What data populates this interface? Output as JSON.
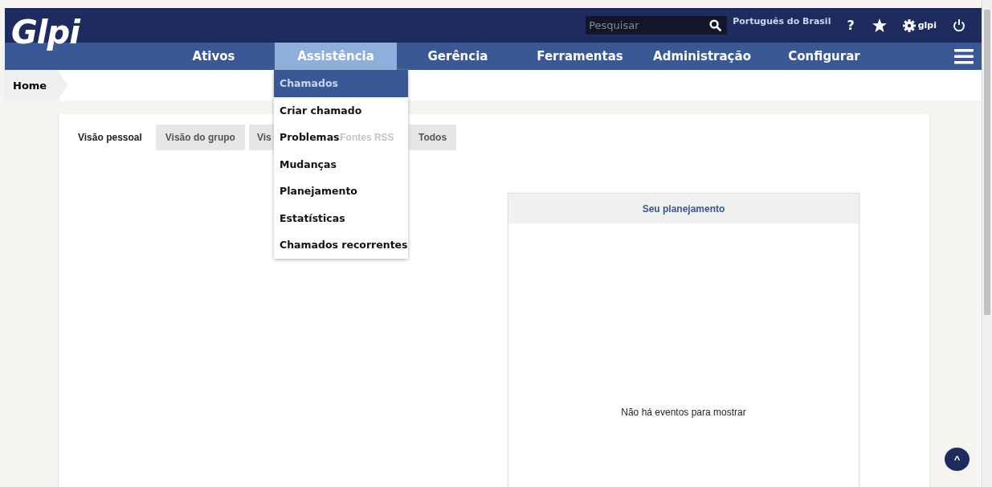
{
  "header": {
    "logo": "Glpi",
    "search": {
      "placeholder": "Pesquisar"
    },
    "language": "Português do Brasil",
    "help": "?",
    "user": "glpi"
  },
  "nav": [
    {
      "label": "Ativos",
      "selected": false
    },
    {
      "label": "Assistência",
      "selected": true
    },
    {
      "label": "Gerência",
      "selected": false
    },
    {
      "label": "Ferramentas",
      "selected": false
    },
    {
      "label": "Administração",
      "selected": false
    },
    {
      "label": "Configurar",
      "selected": false
    }
  ],
  "breadcrumb": [
    "Home"
  ],
  "dropdown": [
    {
      "label": "Chamados",
      "selected": true
    },
    {
      "label": "Criar chamado",
      "selected": false
    },
    {
      "label": "Problemas",
      "selected": false
    },
    {
      "label": "Mudanças",
      "selected": false
    },
    {
      "label": "Planejamento",
      "selected": false
    },
    {
      "label": "Estatísticas",
      "selected": false
    },
    {
      "label": "Chamados recorrentes",
      "selected": false
    }
  ],
  "tabs": [
    {
      "label": "Visão pessoal",
      "selected": true,
      "disabled": false
    },
    {
      "label": "Visão do grupo",
      "selected": false,
      "disabled": false
    },
    {
      "label": "Vis",
      "selected": false,
      "disabled": false
    },
    {
      "label": "Fontes RSS",
      "selected": false,
      "disabled": true
    },
    {
      "label": "Todos",
      "selected": false,
      "disabled": false
    }
  ],
  "planning": {
    "title": "Seu planejamento",
    "empty": "Não há eventos para mostrar"
  },
  "scroll_top": "^"
}
